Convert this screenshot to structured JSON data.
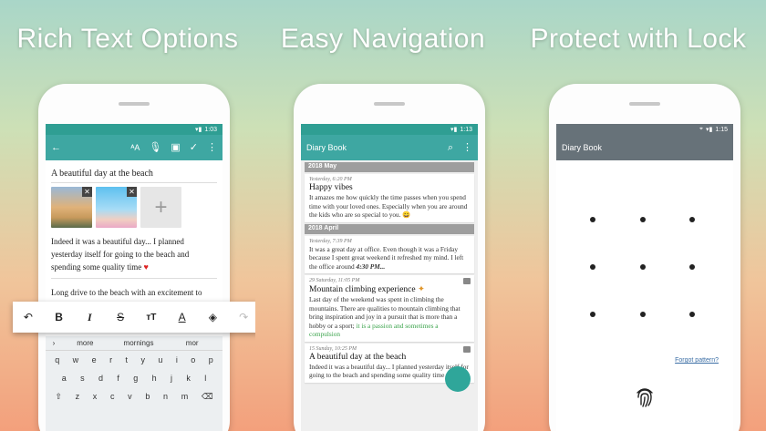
{
  "panel1": {
    "heading": "Rich Text Options",
    "time": "1:03",
    "title": "A beautiful day at the beach",
    "para1": "Indeed it was a beautiful day... I planned yesterday itself for going to the beach and spending some quality time",
    "para2": "Long drive to the beach with an excitement to reach the weekend far from my town. I",
    "suggestions": [
      "more",
      "mornings",
      "mor"
    ],
    "keyboard_row1": [
      "q",
      "w",
      "e",
      "r",
      "t",
      "y",
      "u",
      "i",
      "o",
      "p"
    ],
    "keyboard_row2": [
      "a",
      "s",
      "d",
      "f",
      "g",
      "h",
      "j",
      "k",
      "l"
    ],
    "keyboard_row3": [
      "z",
      "x",
      "c",
      "v",
      "b",
      "n",
      "m"
    ],
    "digits": [
      "1",
      "2",
      "3",
      "4",
      "5",
      "6",
      "7",
      "8",
      "9",
      "0"
    ]
  },
  "panel2": {
    "heading": "Easy Navigation",
    "time": "1:13",
    "app_title": "Diary Book",
    "sections": [
      {
        "label": "2018  May"
      },
      {
        "label": "2018  April"
      }
    ],
    "entries": [
      {
        "date": "Yesterday, 6:20 PM",
        "title": "Happy vibes",
        "text": "It amazes me how quickly the time passes when you spend time with your loved ones. Especially when you are around the kids who are so special to you."
      },
      {
        "date": "Yesterday, 7:39 PM",
        "title": "",
        "text": "It was a great day at office. Even though it was a Friday because I spent great weekend it refreshed my mind. I left the office around",
        "bold": "4:30 PM..."
      },
      {
        "date": "29 Saturday, 11:05 PM",
        "title": "Mountain climbing experience",
        "text": "Last day of the weekend was spent in climbing the mountains. There are qualities to mountain climbing that bring inspiration and joy in a pursuit that is more than a hobby or a sport;",
        "green": "it is a passion and sometimes a compulsion"
      },
      {
        "date": "15 Sunday, 10:25 PM",
        "title": "A beautiful day at the beach",
        "text": "Indeed it was a beautiful day... I planned yesterday itself for going to the beach and spending some quality time"
      }
    ]
  },
  "panel3": {
    "heading": "Protect with Lock",
    "time": "1:15",
    "app_title": "Diary Book",
    "forgot": "Forgot pattern?"
  }
}
